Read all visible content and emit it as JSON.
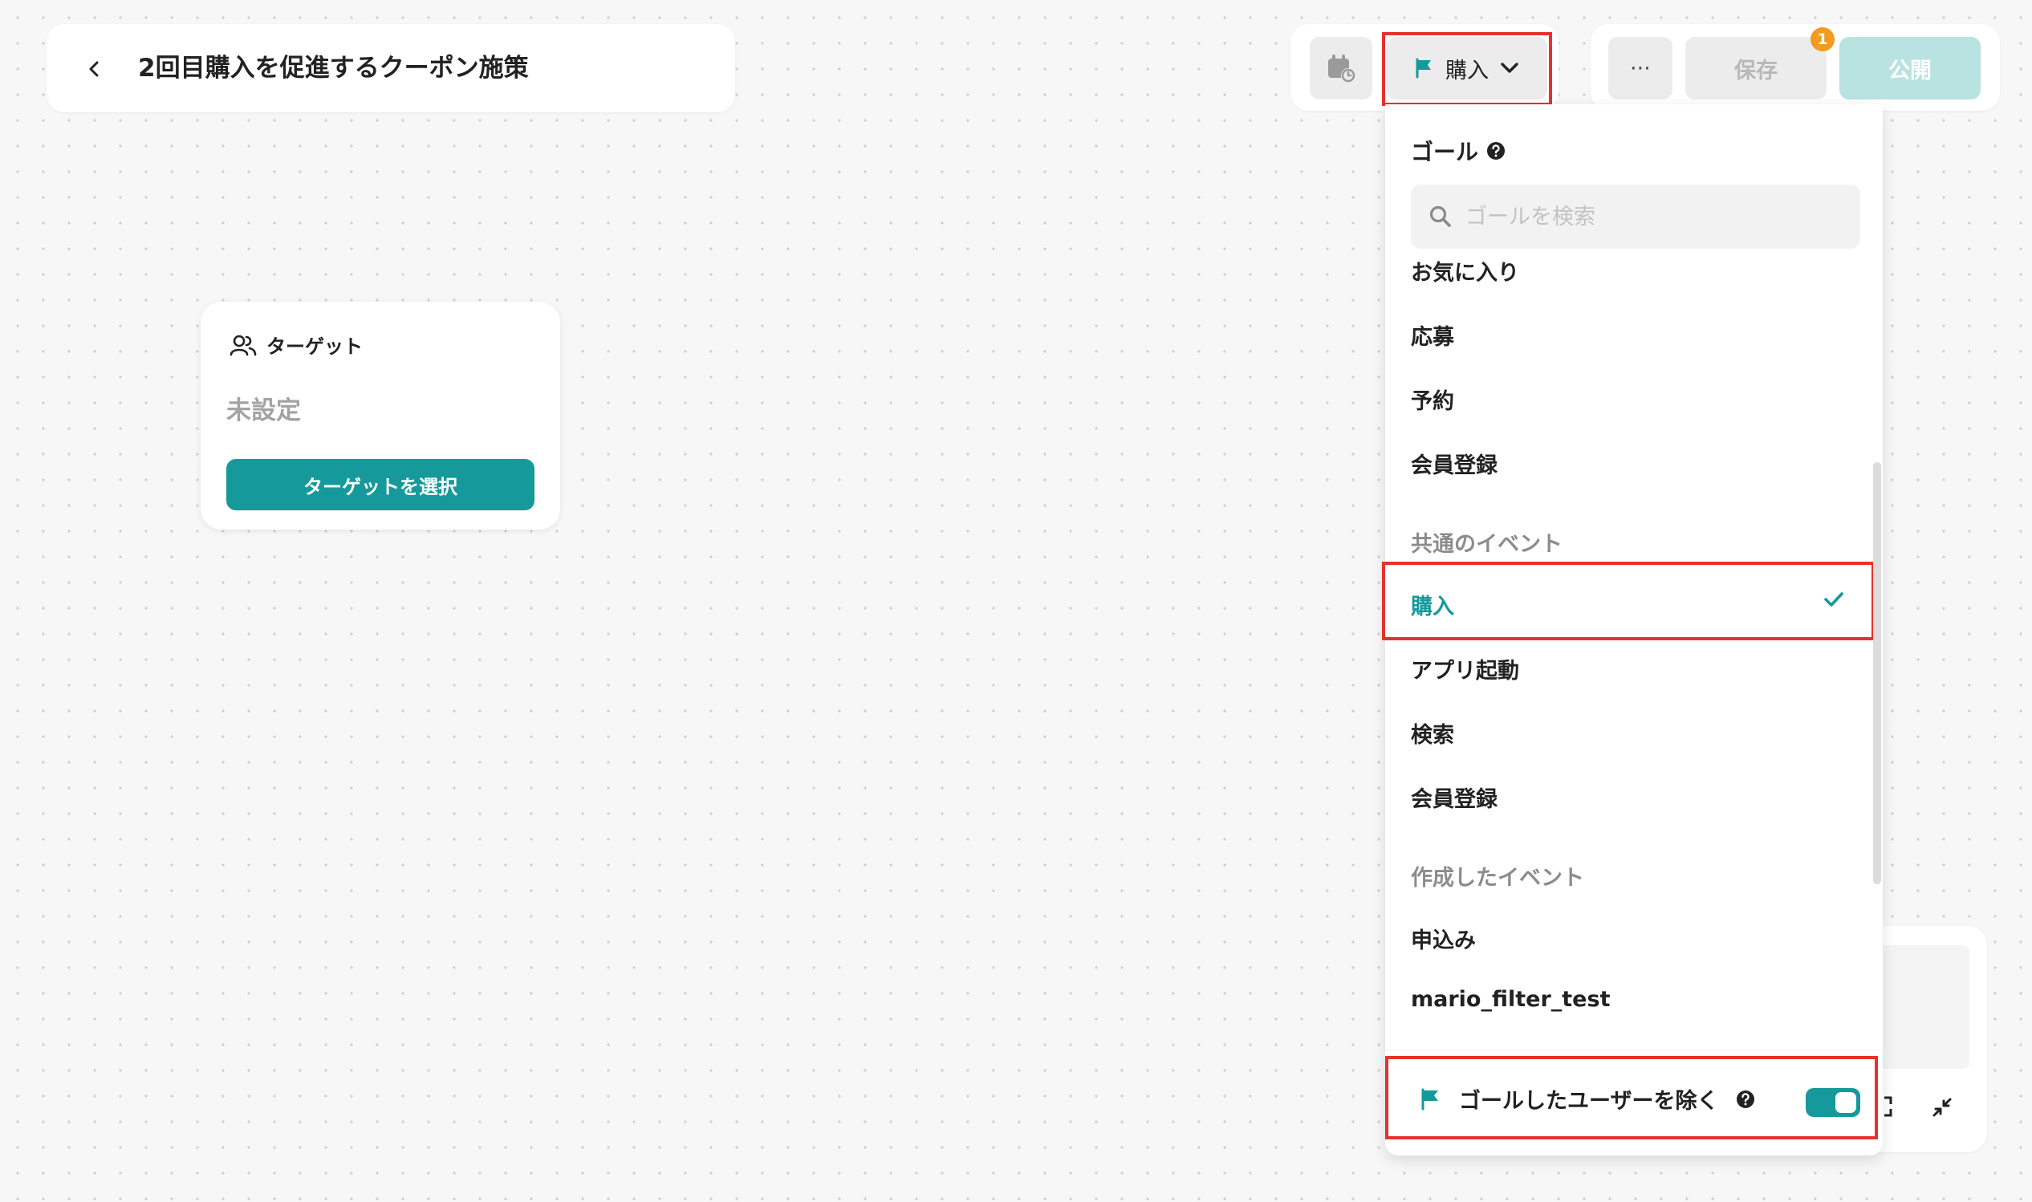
{
  "header": {
    "title": "2回目購入を促進するクーポン施策"
  },
  "toolbar": {
    "goal_button_label": "購入",
    "save_label": "保存",
    "publish_label": "公開",
    "notification_count": "1",
    "more_label": "⋯"
  },
  "target_node": {
    "heading": "ターゲット",
    "value": "未設定",
    "select_button_label": "ターゲットを選択"
  },
  "goal_dropdown": {
    "header": "ゴール",
    "search_placeholder": "ゴールを検索",
    "items_top": [
      "お気に入り",
      "応募",
      "予約",
      "会員登録"
    ],
    "group_common": "共通のイベント",
    "common_items": [
      "購入",
      "アプリ起動",
      "検索",
      "会員登録"
    ],
    "selected_item": "購入",
    "group_created": "作成したイベント",
    "created_items": [
      "申込み",
      "mario_filter_test"
    ],
    "exclude_label": "ゴールしたユーザーを除く",
    "exclude_enabled": true
  },
  "colors": {
    "accent": "#16999a",
    "highlight_border": "#e8312b",
    "badge": "#f29b1d",
    "publish_disabled": "#b8e3e0"
  }
}
